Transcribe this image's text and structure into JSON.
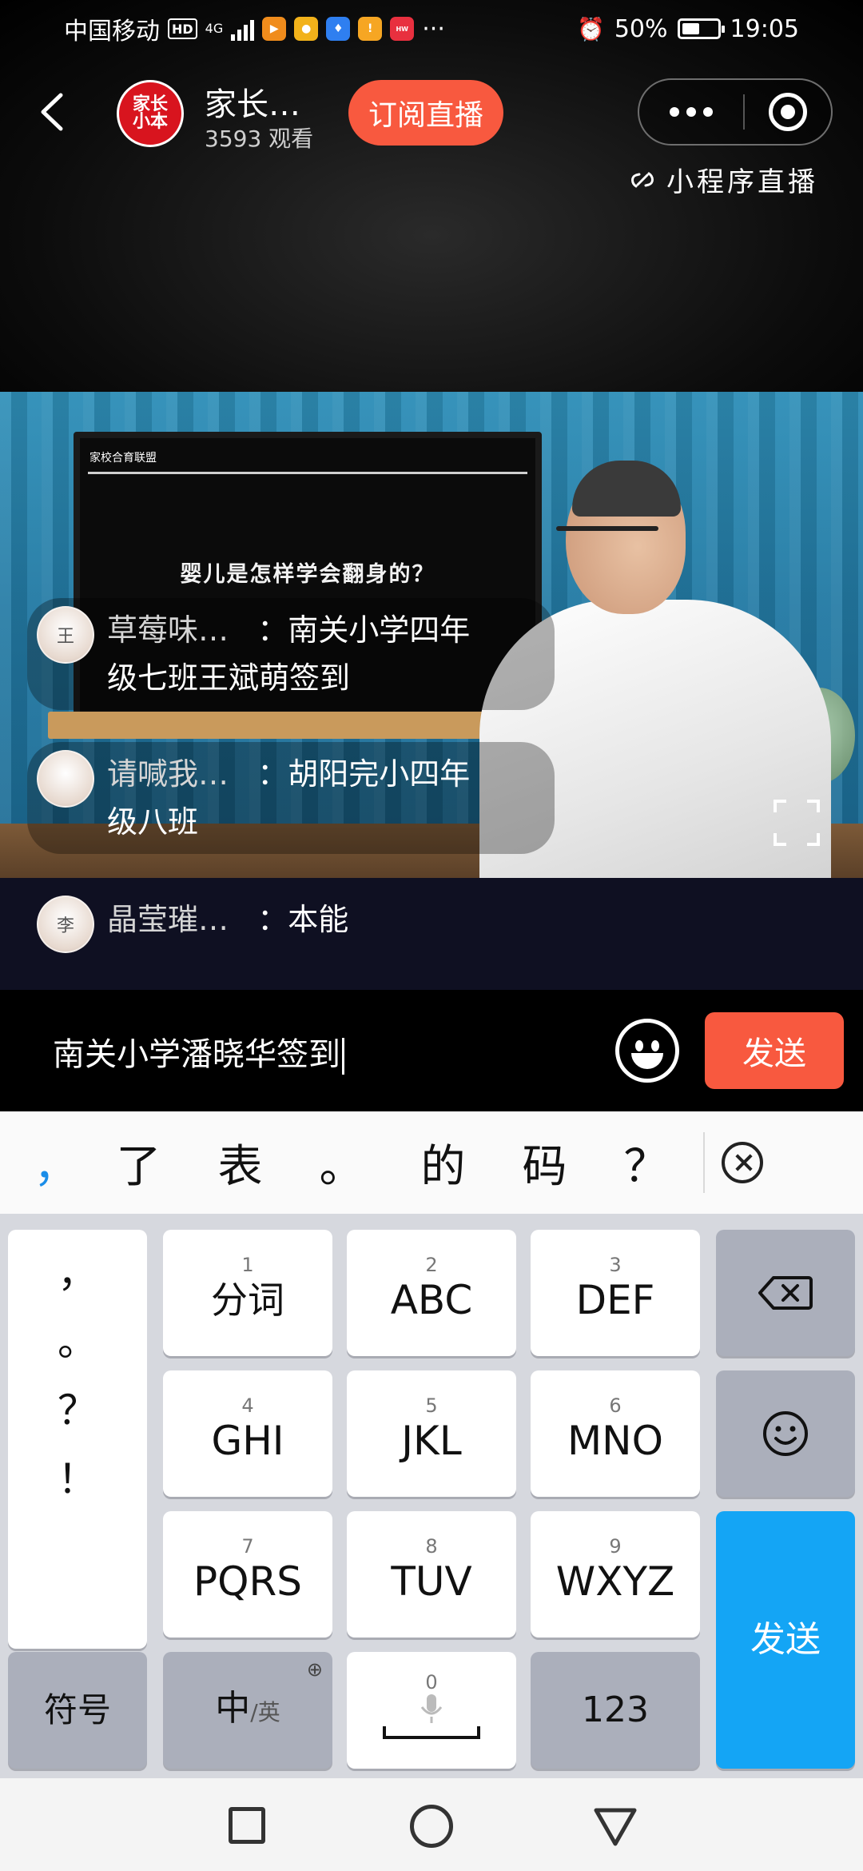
{
  "status_bar": {
    "carrier": "中国移动",
    "hd_badge": "HD",
    "network": "4G",
    "battery_text": "50%",
    "battery_level": 0.5,
    "time": "19:05",
    "app_icons": [
      "video-app-icon",
      "chat-app-icon",
      "bulb-app-icon",
      "orange-app-icon",
      "huawei-app-icon"
    ],
    "more_dots": "···"
  },
  "header": {
    "logo_text_line1": "家长",
    "logo_text_line2": "小本",
    "channel_name": "家长…",
    "viewer_count": "3593 观看",
    "subscribe_label": "订阅直播",
    "mini_program_label": "小程序直播"
  },
  "video": {
    "tv_header": "家校合育联盟",
    "tv_title": "婴儿是怎样学会翻身的？"
  },
  "comments": [
    {
      "name": "草莓味…",
      "sep": "：",
      "text_line1": "南关小学四年",
      "text_line2": "级七班王斌萌签到",
      "avatar_char": "王"
    },
    {
      "name": "请喊我…",
      "sep": "：",
      "text_line1": "胡阳完小四年",
      "text_line2": "级八班",
      "avatar_char": ""
    },
    {
      "name": "晶莹璀…",
      "sep": "：",
      "text_line1": "本能",
      "text_line2": "",
      "avatar_char": "李"
    }
  ],
  "input": {
    "value": "南关小学潘晓华签到",
    "send_label": "发送"
  },
  "candidates": {
    "items": [
      "，",
      "了",
      "表",
      "。",
      "的",
      "码",
      "？"
    ]
  },
  "keyboard": {
    "punctuation": [
      "，",
      "。",
      "？",
      "！"
    ],
    "keys": [
      {
        "num": "1",
        "label": "分词"
      },
      {
        "num": "2",
        "label": "ABC"
      },
      {
        "num": "3",
        "label": "DEF"
      },
      {
        "num": "4",
        "label": "GHI"
      },
      {
        "num": "5",
        "label": "JKL"
      },
      {
        "num": "6",
        "label": "MNO"
      },
      {
        "num": "7",
        "label": "PQRS"
      },
      {
        "num": "8",
        "label": "TUV"
      },
      {
        "num": "9",
        "label": "WXYZ"
      }
    ],
    "symbol_label": "符号",
    "lang_main": "中",
    "lang_alt": "/英",
    "space_num": "0",
    "numbers_label": "123",
    "send_label": "发送"
  },
  "colors": {
    "accent": "#f8593f",
    "keyboard_send": "#14a5f5",
    "candidate_highlight": "#1a8de8"
  }
}
